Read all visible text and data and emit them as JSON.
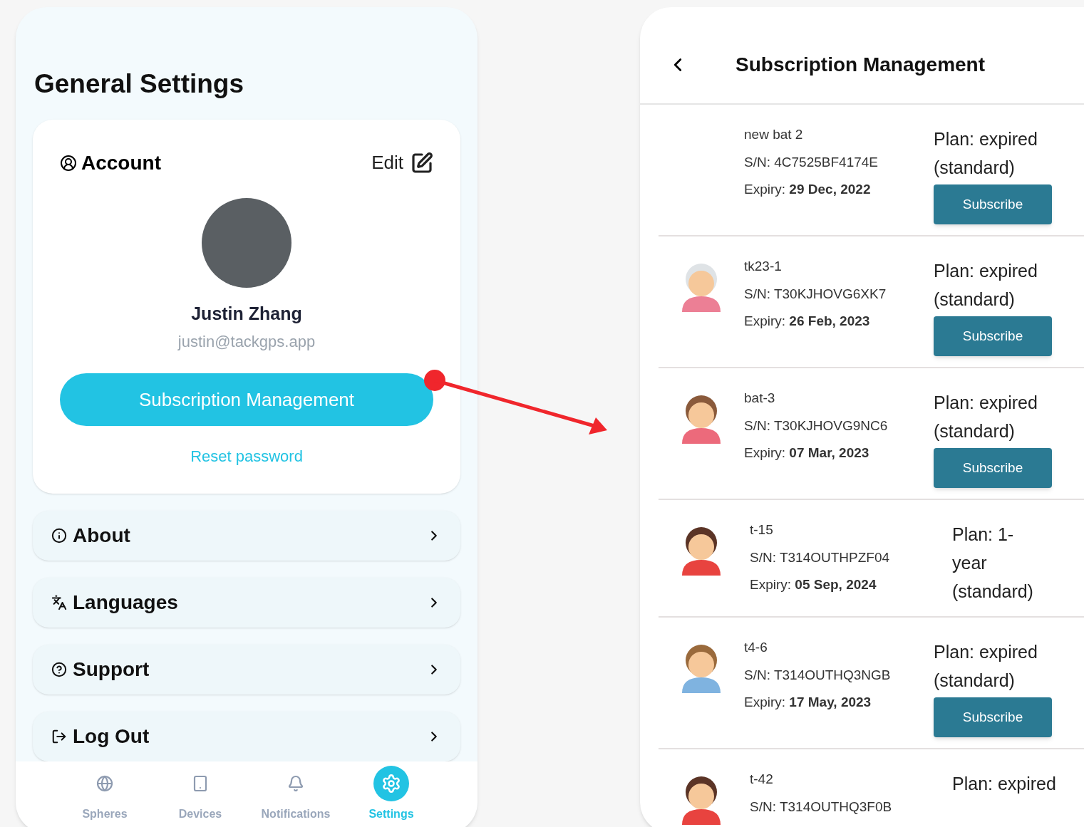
{
  "settings_screen": {
    "title": "General Settings",
    "account": {
      "heading": "Account",
      "edit": "Edit",
      "name": "Justin Zhang",
      "email": "justin@tackgps.app",
      "subscription_button": "Subscription Management",
      "reset_link": "Reset password"
    },
    "menu": [
      {
        "kind": "about",
        "label": "About"
      },
      {
        "kind": "languages",
        "label": "Languages"
      },
      {
        "kind": "support",
        "label": "Support"
      },
      {
        "kind": "logout",
        "label": "Log Out"
      }
    ],
    "nav": [
      {
        "kind": "spheres",
        "label": "Spheres",
        "selected": false
      },
      {
        "kind": "devices",
        "label": "Devices",
        "selected": false
      },
      {
        "kind": "notifications",
        "label": "Notifications",
        "selected": false
      },
      {
        "kind": "settings",
        "label": "Settings",
        "selected": true
      }
    ]
  },
  "subscription_screen": {
    "title": "Subscription Management",
    "devices": [
      {
        "kind": "blank",
        "name": "new bat 2",
        "sn": "S/N: 4C7525BF4174E",
        "expiry_label": "Expiry:",
        "expiry": "29 Dec, 2022",
        "plan": "Plan: expired (standard)",
        "button": "Subscribe"
      },
      {
        "kind": "grandma",
        "name": "tk23-1",
        "sn": "S/N: T30KJHOVG6XK7",
        "expiry_label": "Expiry:",
        "expiry": "26 Feb, 2023",
        "plan": "Plan: expired (standard)",
        "button": "Subscribe"
      },
      {
        "kind": "girl",
        "name": "bat-3",
        "sn": "S/N: T30KJHOVG9NC6",
        "expiry_label": "Expiry:",
        "expiry": "07 Mar, 2023",
        "plan": "Plan: expired (standard)",
        "button": "Subscribe"
      },
      {
        "kind": "braids",
        "name": "t-15",
        "sn": "S/N: T314OUTHPZF04",
        "expiry_label": "Expiry:",
        "expiry": "05 Sep, 2024",
        "plan": "Plan: 1-year (standard)"
      },
      {
        "kind": "pigtails",
        "name": "t4-6",
        "sn": "S/N: T314OUTHQ3NGB",
        "expiry_label": "Expiry:",
        "expiry": "17 May, 2023",
        "plan": "Plan: expired (standard)",
        "button": "Subscribe"
      },
      {
        "kind": "braids",
        "name": "t-42",
        "sn": "S/N: T314OUTHQ3F0B",
        "plan": "Plan: expired"
      }
    ]
  }
}
